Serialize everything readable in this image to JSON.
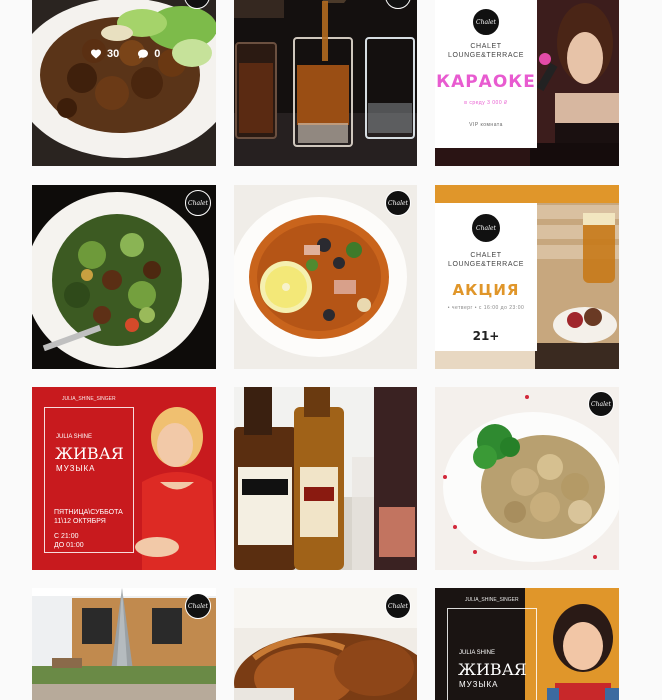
{
  "post1": {
    "likes": "30",
    "comments": "0"
  },
  "brand_logo": "Chalet",
  "karaoke": {
    "brand": "CHALET",
    "brand_sub": "LOUNGE&TERRACE",
    "headline": "КАРАОКЕ",
    "note": "в среду 3 000 ₽",
    "footer": "VIP комната"
  },
  "promo": {
    "brand": "CHALET",
    "brand_sub": "LOUNGE&TERRACE",
    "headline": "АКЦИЯ",
    "note": "• четверг • с 16:00 до 23:00",
    "age": "21+"
  },
  "live1": {
    "handle": "JULIA_SHINE_SINGER",
    "artist": "JULIA SHINE",
    "headline": "ЖИВАЯ",
    "sub": "МУЗЫКА",
    "days": "ПЯТНИЦА\\СУББОТА",
    "dates": "11\\12 ОКТЯБРЯ",
    "time_from": "С 21:00",
    "time_to": "ДО 01:00"
  },
  "live2": {
    "handle": "JULIA_SHINE_SINGER",
    "artist": "JULIA SHINE",
    "headline": "ЖИВАЯ",
    "sub": "МУЗЫКА"
  },
  "colors": {
    "page_bg": "#fafafa",
    "accent_pink": "#e85bd0",
    "accent_orange": "#e0962a",
    "poster_red": "#c81a1e"
  }
}
